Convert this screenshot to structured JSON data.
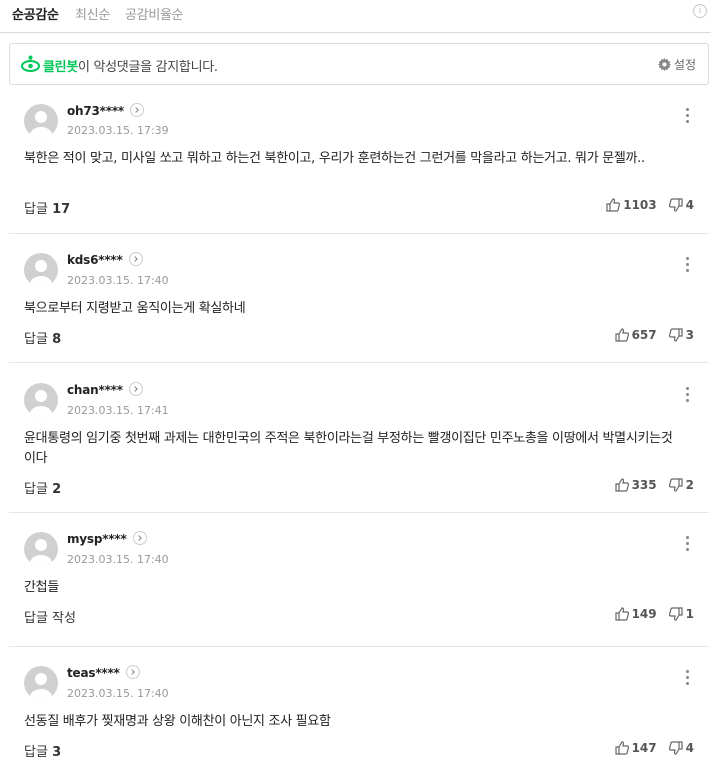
{
  "sort": {
    "tabs": [
      "순공감순",
      "최신순",
      "공감비율순"
    ]
  },
  "cleanbot": {
    "name": "클린봇",
    "message": "이 악성댓글을 감지합니다.",
    "settings_label": "설정"
  },
  "comments": [
    {
      "user": "oh73****",
      "date": "2023.03.15. 17:39",
      "text": "북한은 적이 맞고, 미사일 쏘고 뭐하고 하는건 북한이고, 우리가 훈련하는건 그런거를 막을라고 하는거고. 뭐가 문젤까..",
      "reply_label": "답글",
      "reply_count": "17",
      "likes": "1103",
      "dislikes": "4"
    },
    {
      "user": "kds6****",
      "date": "2023.03.15. 17:40",
      "text": "북으로부터 지령받고 움직이는게 확실하네",
      "reply_label": "답글",
      "reply_count": "8",
      "likes": "657",
      "dislikes": "3"
    },
    {
      "user": "chan****",
      "date": "2023.03.15. 17:41",
      "text": "윤대통령의 임기중 첫번째 과제는 대한민국의 주적은 북한이라는걸 부정하는 빨갱이집단 민주노총을 이땅에서 박멸시키는것이다",
      "reply_label": "답글",
      "reply_count": "2",
      "likes": "335",
      "dislikes": "2"
    },
    {
      "user": "mysp****",
      "date": "2023.03.15. 17:40",
      "text": "간첩들",
      "reply_label": "답글 작성",
      "reply_count": "",
      "likes": "149",
      "dislikes": "1"
    },
    {
      "user": "teas****",
      "date": "2023.03.15. 17:40",
      "text": "선동질 배후가 찢재명과 상왕 이해찬이 아닌지 조사 필요함",
      "reply_label": "답글",
      "reply_count": "3",
      "likes": "147",
      "dislikes": "4"
    }
  ]
}
